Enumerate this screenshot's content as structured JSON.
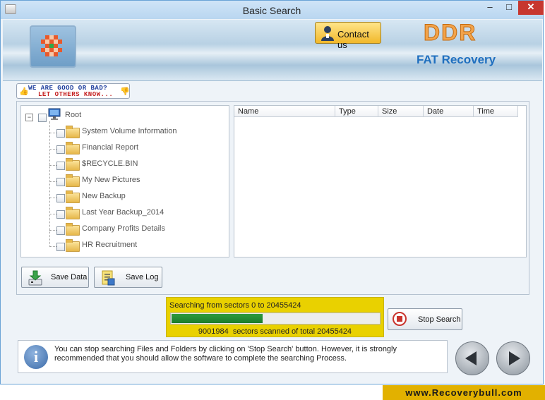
{
  "window": {
    "title": "Basic Search",
    "minimize": "–",
    "maximize": "□",
    "close": "✕"
  },
  "banner": {
    "contact_label": "Contact us",
    "brand": "DDR",
    "product": "FAT Recovery"
  },
  "feedback": {
    "line1": "WE ARE GOOD OR BAD?",
    "line2": "LET OTHERS KNOW..."
  },
  "tree": {
    "root": "Root",
    "items": [
      {
        "label": "System Volume Information"
      },
      {
        "label": "Financial Report"
      },
      {
        "label": "$RECYCLE.BIN"
      },
      {
        "label": "My New Pictures"
      },
      {
        "label": "New Backup"
      },
      {
        "label": "Last Year Backup_2014"
      },
      {
        "label": "Company Profits Details"
      },
      {
        "label": "HR Recruitment"
      }
    ]
  },
  "file_list": {
    "columns": [
      "Name",
      "Type",
      "Size",
      "Date",
      "Time"
    ]
  },
  "actions": {
    "save_data": "Save Data",
    "save_log": "Save Log",
    "stop_search": "Stop Search"
  },
  "progress": {
    "range_text": "Searching from sectors 0 to 20455424",
    "scanned": "9001984",
    "scanned_suffix": "sectors scanned of total 20455424",
    "fraction": 0.44
  },
  "info": {
    "message": "You can stop searching Files and Folders by clicking on 'Stop Search' button. However, it is strongly recommended that you should allow the software to complete the searching Process."
  },
  "footer": {
    "url": "www.Recoverybull.com"
  },
  "colors": {
    "progress_fill": "#1c7c2c",
    "progress_box": "#e9d100",
    "footer_band": "#e2b100",
    "brand_orange": "#f2a34a",
    "product_blue": "#1f6fbf"
  }
}
